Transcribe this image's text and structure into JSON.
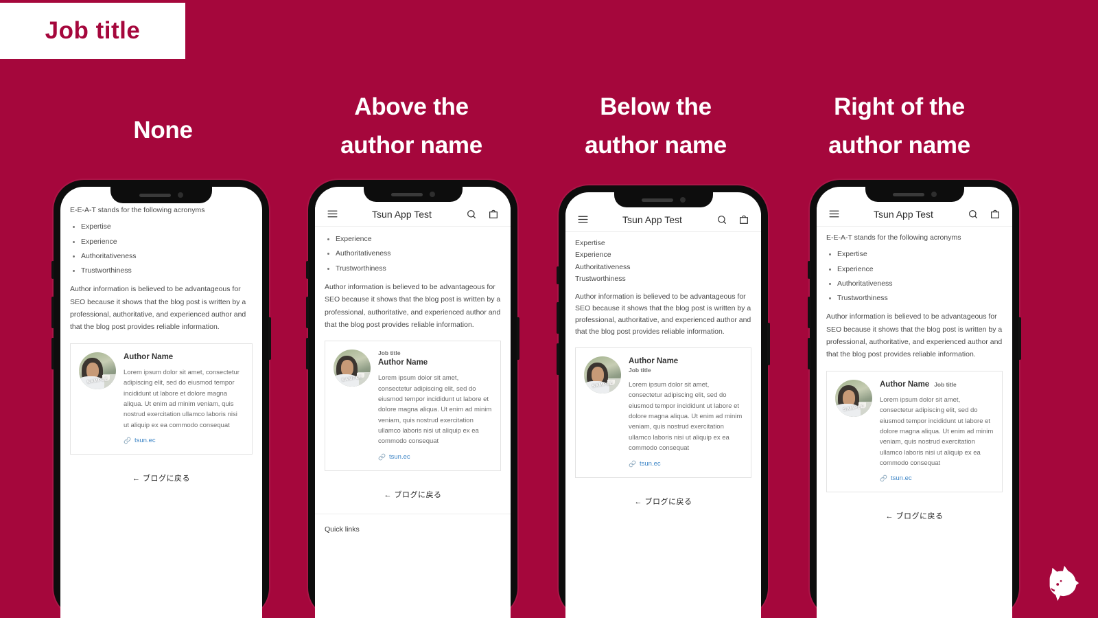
{
  "badge": {
    "label": "Job title"
  },
  "headings": [
    {
      "line1": "None",
      "line2": ""
    },
    {
      "line1": "Above the",
      "line2": "author name"
    },
    {
      "line1": "Below the",
      "line2": "author name"
    },
    {
      "line1": "Right of the",
      "line2": "author name"
    }
  ],
  "app": {
    "title": "Tsun App Test",
    "menu_icon": "hamburger-icon",
    "search_icon": "search-icon",
    "cart_icon": "shopping-bag-icon"
  },
  "article": {
    "lead": "E-E-A-T stands for the following acronyms",
    "acronyms": [
      "Expertise",
      "Experience",
      "Authoritativeness",
      "Trustworthiness"
    ],
    "paragraph": "Author information is believed to be advantageous for SEO because it shows that the blog post is written by a professional, authoritative, and experienced author and that the blog post provides reliable information."
  },
  "author": {
    "name": "Author Name",
    "job_title": "Job title",
    "bio": "Lorem ipsum dolor sit amet, consectetur adipiscing elit, sed do eiusmod tempor incididunt ut labore et dolore magna aliqua. Ut enim ad minim veniam, quis nostrud exercitation ullamco laboris nisi ut aliquip ex ea commodo consequat",
    "link_text": "tsun.ec",
    "link_icon": "link-icon",
    "avatar_watermark": "SAMPLE",
    "avatar_alt": "author-avatar"
  },
  "footer": {
    "back_link": "← ブログに戻る",
    "quick_links": "Quick links"
  },
  "colors": {
    "background": "#a5073c",
    "badge_text": "#a5073c",
    "heading_text": "#ffffff",
    "link_blue": "#3d85c6",
    "body_text": "#4a4a4a"
  },
  "logo": {
    "name": "dog-head-logo"
  }
}
